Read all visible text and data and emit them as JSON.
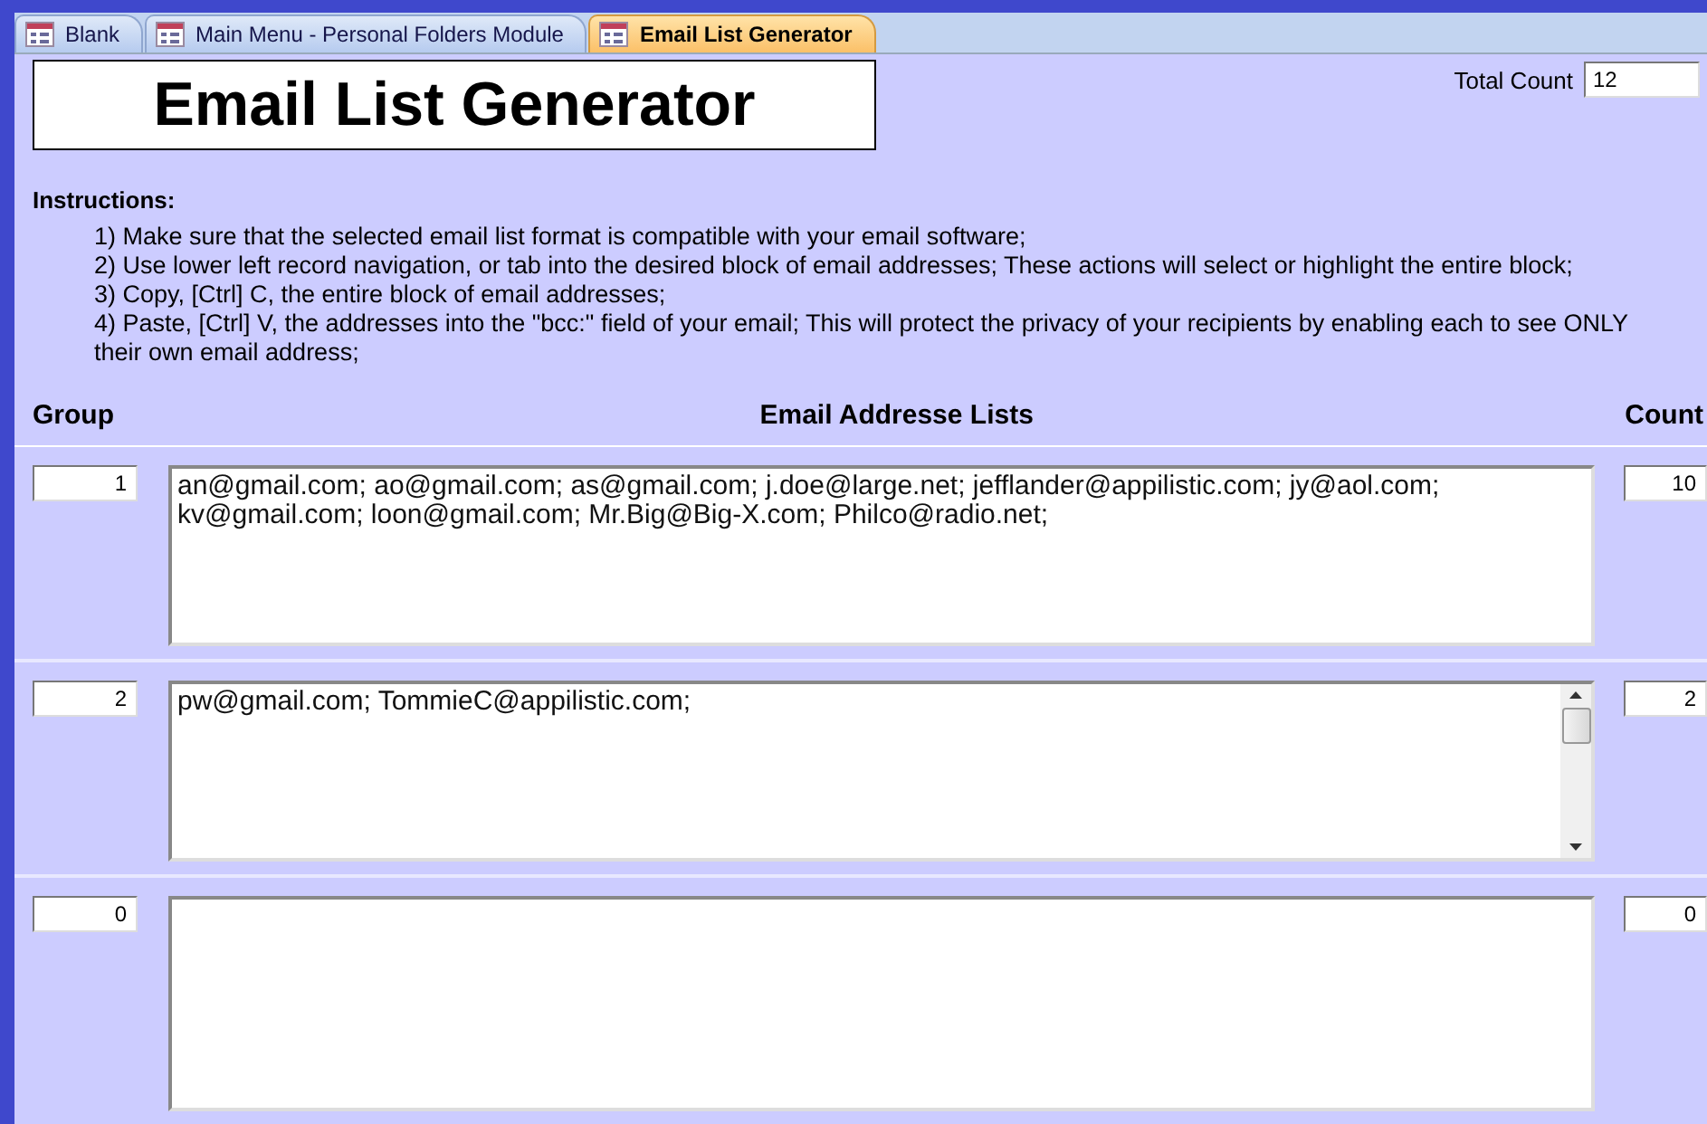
{
  "tabs": [
    {
      "label": "Blank",
      "selected": false
    },
    {
      "label": "Main Menu - Personal Folders Module",
      "selected": false
    },
    {
      "label": "Email List Generator",
      "selected": true
    }
  ],
  "form": {
    "title": "Email List Generator",
    "total_count": {
      "label": "Total Count",
      "value": "12"
    },
    "instructions": {
      "heading": "Instructions:",
      "steps": [
        "1)  Make sure that the selected email list format is compatible with your email software;",
        "2)  Use lower left record navigation, or tab into the desired block of email addresses;  These actions will select or highlight the entire block;",
        "3)  Copy, [Ctrl] C, the entire block of email addresses;",
        "4)  Paste, [Ctrl] V, the addresses into the \"bcc:\" field of your email;  This will protect the privacy of your recipients by enabling each to see ONLY their own email address;"
      ]
    },
    "columns": [
      "Group",
      "Email Addresse Lists",
      "Count"
    ],
    "rows": [
      {
        "group": "1",
        "emails": "an@gmail.com; ao@gmail.com; as@gmail.com; j.doe@large.net; jefflander@appilistic.com; jy@aol.com; kv@gmail.com; loon@gmail.com; Mr.Big@Big-X.com; Philco@radio.net;",
        "count": "10",
        "scrollbar": false
      },
      {
        "group": "2",
        "emails": "pw@gmail.com; TommieC@appilistic.com;",
        "count": "2",
        "scrollbar": true
      },
      {
        "group": "0",
        "count": "0",
        "scrollbar": false
      }
    ]
  }
}
